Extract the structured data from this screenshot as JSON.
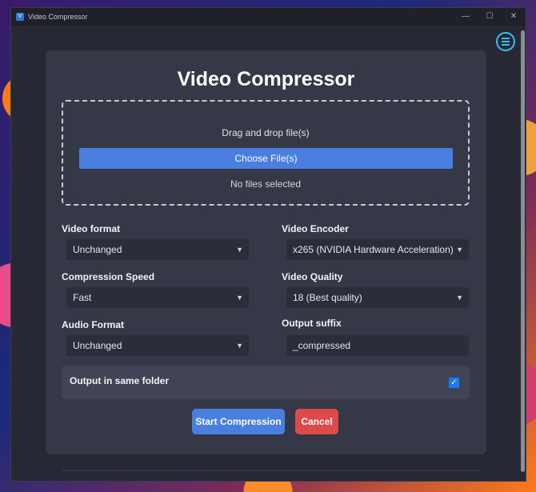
{
  "window": {
    "title": "Video Compressor",
    "controls": {
      "minimize": "—",
      "maximize": "☐",
      "close": "✕"
    }
  },
  "heading": "Video Compressor",
  "dropzone": {
    "prompt": "Drag and drop file(s)",
    "choose_label": "Choose File(s)",
    "status": "No files selected"
  },
  "fields": {
    "video_format": {
      "label": "Video format",
      "value": "Unchanged"
    },
    "video_encoder": {
      "label": "Video Encoder",
      "value": "x265 (NVIDIA Hardware Acceleration)"
    },
    "compression_speed": {
      "label": "Compression Speed",
      "value": "Fast"
    },
    "video_quality": {
      "label": "Video Quality",
      "value": "18 (Best quality)"
    },
    "audio_format": {
      "label": "Audio Format",
      "value": "Unchanged"
    },
    "output_suffix": {
      "label": "Output suffix",
      "value": "_compressed"
    }
  },
  "same_folder": {
    "label": "Output in same folder",
    "checked": true
  },
  "actions": {
    "start_label": "Start Compression",
    "cancel_label": "Cancel"
  },
  "colors": {
    "accent": "#4a7fe0",
    "danger": "#dd4a4a",
    "menu": "#35c0f0"
  }
}
